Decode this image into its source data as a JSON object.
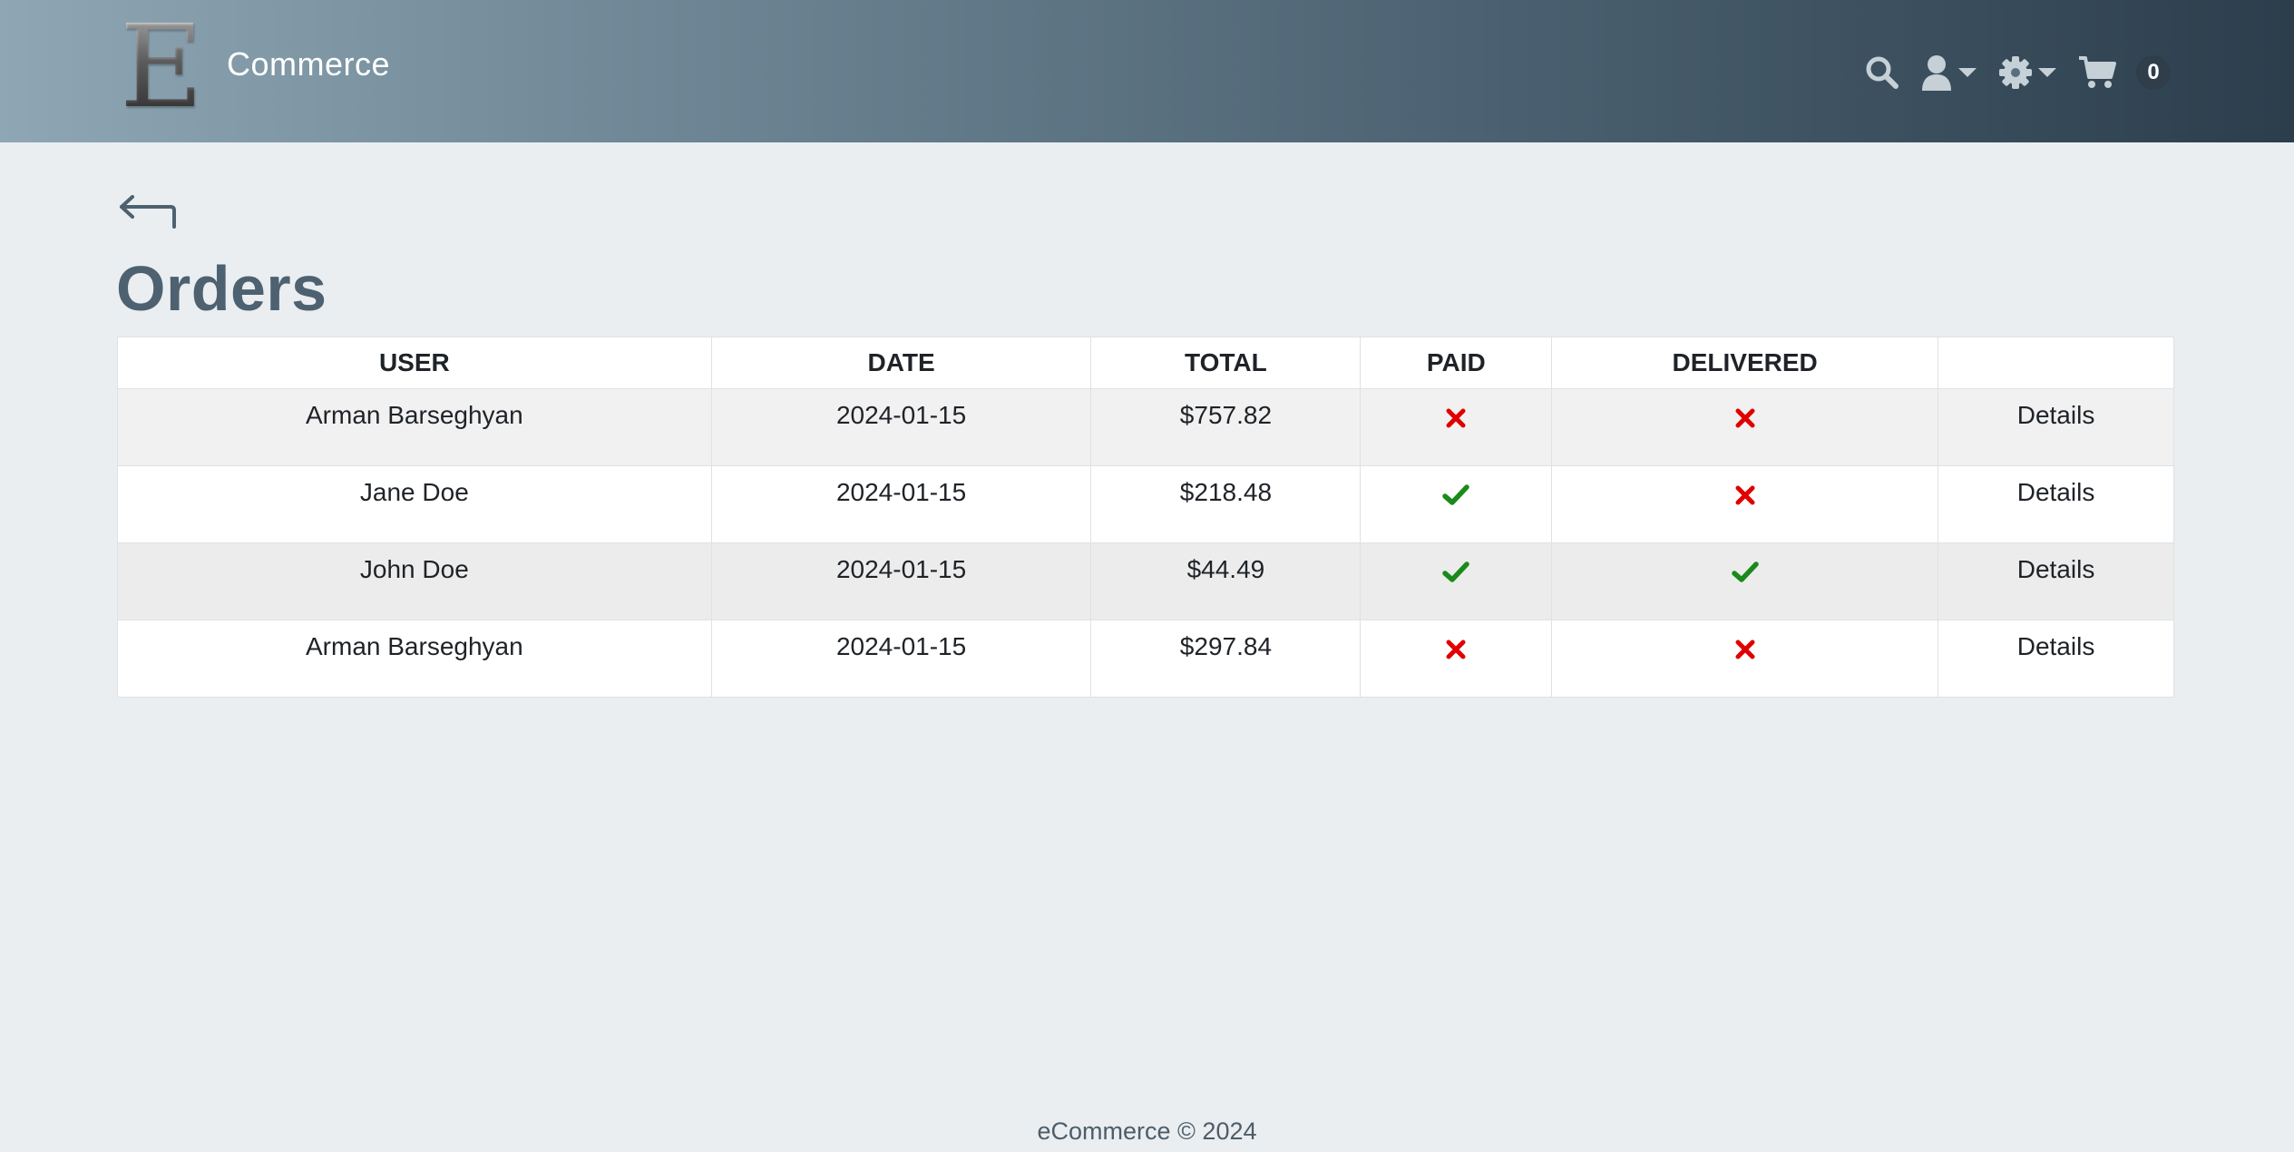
{
  "header": {
    "logo_letter": "E",
    "brand_name": "Commerce",
    "nav": {
      "search_icon": "search-icon",
      "user_icon": "user-icon",
      "settings_icon": "gear-icon",
      "cart_icon": "cart-icon",
      "cart_count": "0"
    }
  },
  "page": {
    "back_icon": "back-arrow-icon",
    "title": "Orders"
  },
  "table": {
    "headers": [
      "USER",
      "DATE",
      "TOTAL",
      "PAID",
      "DELIVERED",
      ""
    ],
    "rows": [
      {
        "user": "Arman Barseghyan",
        "date": "2024-01-15",
        "total": "$757.82",
        "paid": false,
        "delivered": false,
        "action": "Details"
      },
      {
        "user": "Jane Doe",
        "date": "2024-01-15",
        "total": "$218.48",
        "paid": true,
        "delivered": false,
        "action": "Details"
      },
      {
        "user": "John Doe",
        "date": "2024-01-15",
        "total": "$44.49",
        "paid": true,
        "delivered": true,
        "action": "Details"
      },
      {
        "user": "Arman Barseghyan",
        "date": "2024-01-15",
        "total": "$297.84",
        "paid": false,
        "delivered": false,
        "action": "Details"
      }
    ]
  },
  "colors": {
    "check": "#1a8a1a",
    "cross": "#e00000",
    "title": "#4d6170"
  },
  "footer": {
    "text": "eCommerce © 2024"
  }
}
